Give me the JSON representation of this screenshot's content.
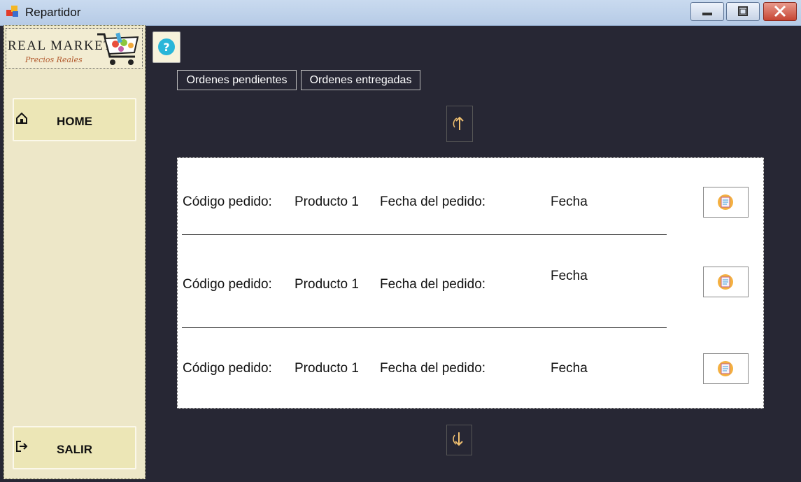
{
  "window": {
    "title": "Repartidor"
  },
  "sidebar": {
    "logo": {
      "brand": "REAL MARKET",
      "tagline": "Precios Reales"
    },
    "home_label": "HOME",
    "logout_label": "SALIR"
  },
  "tabs": [
    {
      "label": "Ordenes pendientes"
    },
    {
      "label": "Ordenes entregadas"
    }
  ],
  "orders": [
    {
      "code_label": "Código pedido:",
      "product": "Producto 1",
      "date_label": "Fecha del pedido:",
      "date_value": "Fecha"
    },
    {
      "code_label": "Código pedido:",
      "product": "Producto 1",
      "date_label": "Fecha del pedido:",
      "date_value": "Fecha"
    },
    {
      "code_label": "Código pedido:",
      "product": "Producto 1",
      "date_label": "Fecha del pedido:",
      "date_value": "Fecha"
    }
  ],
  "icons": {
    "help": "help-icon",
    "home": "home-icon",
    "logout": "logout-icon",
    "scroll_up": "arrow-up-icon",
    "scroll_down": "arrow-down-icon",
    "order_action": "order-detail-icon"
  },
  "colors": {
    "background": "#272734",
    "sidebar": "#ede7c8",
    "nav_button": "#ece6b6",
    "accent": "#f0c070"
  }
}
